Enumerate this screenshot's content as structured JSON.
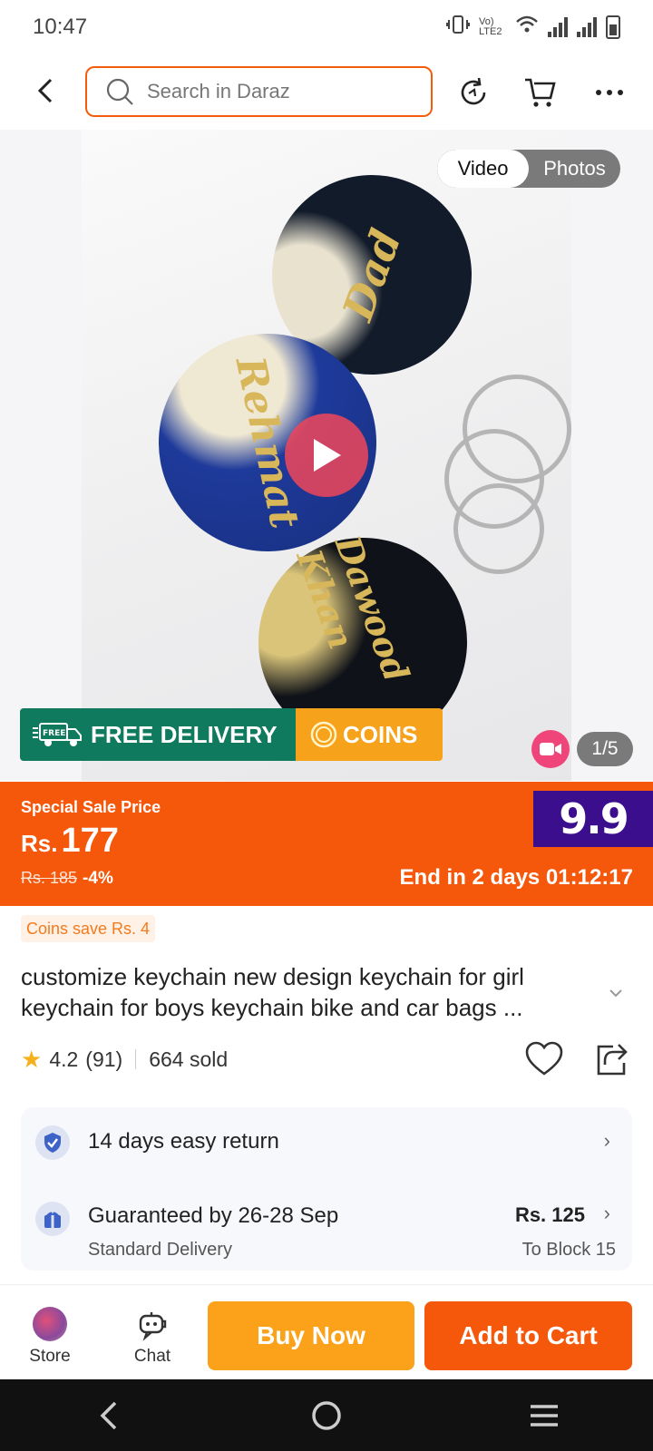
{
  "status_bar": {
    "time": "10:47",
    "network_label": "Vo) LTE2"
  },
  "header": {
    "search_placeholder": "Search in Daraz"
  },
  "gallery": {
    "media_tabs": [
      "Video",
      "Photos"
    ],
    "active_tab": "Video",
    "counter": "1/5",
    "tags": [
      "Dad",
      "Rehmat",
      "Dawood Khan"
    ],
    "banner": {
      "free_delivery": "FREE DELIVERY",
      "coins": "COINS",
      "free_badge": "FREE"
    }
  },
  "price": {
    "label": "Special Sale Price",
    "currency": "Rs.",
    "amount": "177",
    "old_price": "Rs. 185",
    "discount": "-4%",
    "event_badge": "9.9",
    "countdown": "End in 2 days 01:12:17"
  },
  "coins_save": "Coins save Rs. 4",
  "product": {
    "title_line1": "customize keychain new design keychain for girl",
    "title_line2": "keychain for boys keychain bike and car bags ...",
    "rating": "4.2",
    "reviews": "(91)",
    "sold": "664 sold"
  },
  "services": {
    "return": "14 days easy return",
    "delivery_title": "Guaranteed by 26-28 Sep",
    "delivery_type": "Standard Delivery",
    "delivery_price": "Rs. 125",
    "delivery_dest": "To Block 15"
  },
  "actions": {
    "store": "Store",
    "chat": "Chat",
    "buy_now": "Buy Now",
    "add_to_cart": "Add to Cart"
  },
  "colors": {
    "brand_orange": "#f5570b",
    "buy_now": "#fba21a",
    "free_delivery_green": "#0f7a5e",
    "coins_orange": "#f6a21a",
    "event_purple": "#3a0e8c"
  }
}
